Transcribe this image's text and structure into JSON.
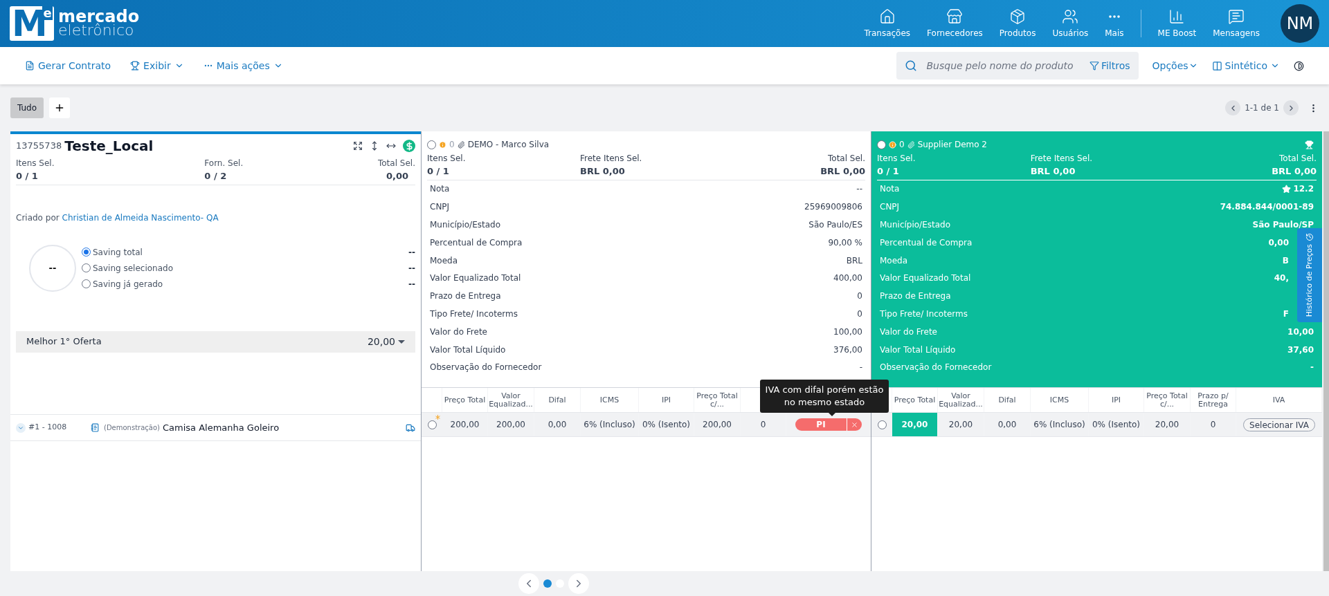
{
  "header": {
    "logo": {
      "mark": "M",
      "mark_sup": "e",
      "line1": "mercado",
      "line2": "eletrônico"
    },
    "nav": [
      {
        "label": "Transações"
      },
      {
        "label": "Fornecedores"
      },
      {
        "label": "Produtos"
      },
      {
        "label": "Usuários"
      },
      {
        "label": "Mais"
      }
    ],
    "nav_right": [
      {
        "label": "ME Boost"
      },
      {
        "label": "Mensagens"
      }
    ],
    "avatar": "NM"
  },
  "toolbar": {
    "actions": [
      {
        "label": "Gerar Contrato",
        "caret": false
      },
      {
        "label": "Exibir",
        "caret": true
      },
      {
        "label": "Mais ações",
        "caret": true
      }
    ],
    "search": {
      "placeholder": "Busque pelo nome do produto"
    },
    "filters": "Filtros",
    "options": "Opções",
    "view": "Sintético"
  },
  "tabs": [
    {
      "label": "Tudo",
      "selected": true
    }
  ],
  "pager": "1-1 de 1",
  "summary": {
    "id": "13755738",
    "title": "Teste_Local",
    "stats": [
      {
        "label": "Itens Sel.",
        "value": "0 / 1"
      },
      {
        "label": "Forn. Sel.",
        "value": "0 / 2"
      },
      {
        "label": "Total Sel.",
        "value": "0,00"
      }
    ],
    "created_by_prefix": "Criado por",
    "created_by": "Christian de Almeida Nascimento- QA",
    "gauge": "--",
    "savings": [
      {
        "label": "Saving total",
        "selected": true,
        "value": "--"
      },
      {
        "label": "Saving selecionado",
        "selected": false,
        "value": "--"
      },
      {
        "label": "Saving já gerado",
        "selected": false,
        "value": "--"
      }
    ],
    "best_offer": {
      "label": "Melhor 1° Oferta",
      "value": "20,00"
    },
    "items": [
      {
        "expanded": false,
        "number": "#1 - 1008",
        "tag": "(Demonstração)",
        "name": "Camisa Alemanha Goleiro"
      }
    ]
  },
  "suppliers": [
    {
      "name": "DEMO - Marco Silva",
      "selected": false,
      "count": "0",
      "winner": false,
      "highlighted": false,
      "stats": [
        {
          "label": "Itens Sel.",
          "value": "0 / 1"
        },
        {
          "label": "Frete Itens Sel.",
          "value": "BRL 0,00"
        },
        {
          "label": "Total Sel.",
          "value": "BRL 0,00"
        }
      ],
      "details": [
        {
          "label": "Nota",
          "value": "--"
        },
        {
          "label": "CNPJ",
          "value": "25969009806"
        },
        {
          "label": "Município/Estado",
          "value": "São Paulo/ES"
        },
        {
          "label": "Percentual de Compra",
          "value": "90,00 %"
        },
        {
          "label": "Moeda",
          "value": "BRL"
        },
        {
          "label": "Valor Equalizado Total",
          "value": "400,00"
        },
        {
          "label": "Prazo de Entrega",
          "value": "0"
        },
        {
          "label": "Tipo Frete/ Incoterms",
          "value": "0"
        },
        {
          "label": "Valor do Frete",
          "value": "100,00"
        },
        {
          "label": "Valor Total Líquido",
          "value": "376,00"
        },
        {
          "label": "Observação do Fornecedor",
          "value": "-"
        }
      ],
      "columns": [
        "Preço Total",
        "Valor Equalizad...",
        "Difal",
        "ICMS",
        "IPI",
        "Preço Total c/..."
      ],
      "row": {
        "selected": false,
        "changed": true,
        "best": false,
        "cells": [
          "200,00",
          "200,00",
          "0,00",
          "6% (Incluso)",
          "0% (Isento)",
          "200,00",
          "0"
        ],
        "iva": {
          "kind": "badge",
          "text": "PI"
        }
      }
    },
    {
      "name": "Supplier Demo 2",
      "selected": false,
      "count": "0",
      "winner": true,
      "highlighted": true,
      "stats": [
        {
          "label": "Itens Sel.",
          "value": "0 / 1"
        },
        {
          "label": "Frete Itens Sel.",
          "value": "BRL 0,00"
        },
        {
          "label": "Total Sel.",
          "value": "BRL 0,00"
        }
      ],
      "details": [
        {
          "label": "Nota",
          "value": "12.2",
          "kind": "rating"
        },
        {
          "label": "CNPJ",
          "value": "74.884.844/0001-89"
        },
        {
          "label": "Município/Estado",
          "value": "São Paulo/SP"
        },
        {
          "label": "Percentual de Compra",
          "value": "0,00",
          "partial": true
        },
        {
          "label": "Moeda",
          "value": "B",
          "partial": true
        },
        {
          "label": "Valor Equalizado Total",
          "value": "40,",
          "partial": true
        },
        {
          "label": "Prazo de Entrega"
        },
        {
          "label": "Tipo Frete/ Incoterms",
          "value": "F",
          "partial": true
        },
        {
          "label": "Valor do Frete",
          "value": "10,00"
        },
        {
          "label": "Valor Total Líquido",
          "value": "37,60"
        },
        {
          "label": "Observação do Fornecedor",
          "value": "-"
        }
      ],
      "columns": [
        "Preço Total",
        "Valor Equalizad...",
        "Difal",
        "ICMS",
        "IPI",
        "Preço Total c/...",
        "Prazo p/ Entrega",
        "IVA"
      ],
      "row": {
        "selected": false,
        "changed": false,
        "best": true,
        "cells": [
          "20,00",
          "20,00",
          "0,00",
          "6% (Incluso)",
          "0% (Isento)",
          "20,00",
          "0"
        ],
        "iva": {
          "kind": "button",
          "text": "Selecionar IVA"
        }
      }
    }
  ],
  "tooltip": "IVA com difal porém estão no mesmo estado",
  "side_tab": "Histórico de Preços",
  "carousel": [
    {
      "selected": true
    },
    {
      "selected": false
    }
  ]
}
